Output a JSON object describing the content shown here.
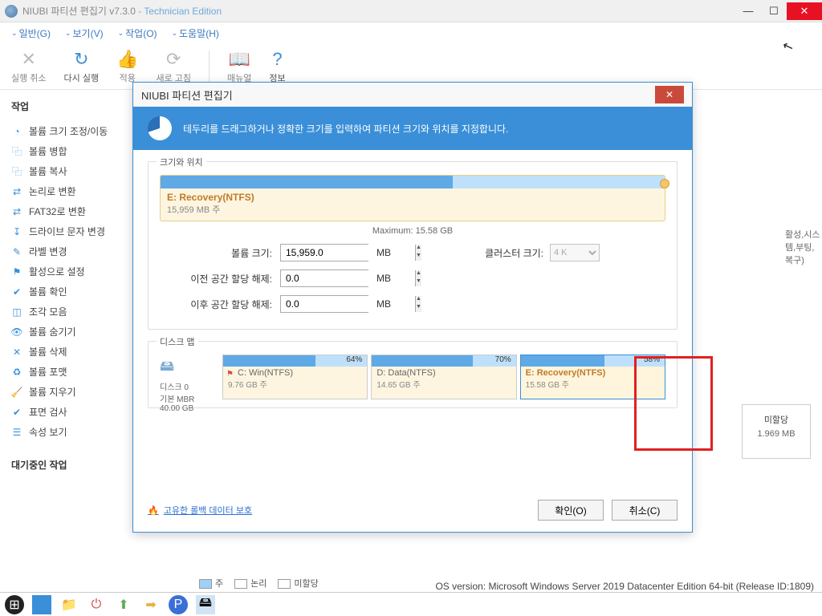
{
  "titlebar": {
    "name": "NIUBI 파티션 편집기 v7.3.0",
    "edition": " - Technician Edition"
  },
  "menu": {
    "general": "일반(G)",
    "view": "보기(V)",
    "action": "작업(O)",
    "help": "도움말(H)"
  },
  "toolbar": {
    "undo": "실행 취소",
    "redo": "다시 실행",
    "apply": "적용",
    "refresh": "새로 고침",
    "manual": "매뉴얼",
    "info": "정보"
  },
  "sidebar": {
    "header": "작업",
    "items": [
      "볼륨 크기 조정/이동",
      "볼륨 병합",
      "볼륨 복사",
      "논리로 변환",
      "FAT32로 변환",
      "드라이브 문자 변경",
      "라벨 변경",
      "활성으로 설정",
      "볼륨 확인",
      "조각 모음",
      "볼륨 숨기기",
      "볼륨 삭제",
      "볼륨 포맷",
      "볼륨 지우기",
      "표면 검사",
      "속성 보기"
    ],
    "pending": "대기중인 작업"
  },
  "back": {
    "badge": "활성,시스템,부팅,복구)",
    "unalloc": "미할당",
    "unalloc_sz": "1.969 MB"
  },
  "dialog": {
    "title": "NIUBI 파티션 편집기",
    "banner": "테두리를 드래그하거나 정확한 크기를 입력하여 파티션 크기와 위치를 지정합니다.",
    "group_size": "크기와 위치",
    "part_name": "E: Recovery(NTFS)",
    "part_size": "15,959 MB 주",
    "maximum": "Maximum: 15.58 GB",
    "lbl_volsize": "볼륨 크기:",
    "val_volsize": "15,959.0",
    "lbl_before": "이전 공간 할당 해제:",
    "val_before": "0.0",
    "lbl_after": "이후 공간 할당 해제:",
    "val_after": "0.0",
    "unit": "MB",
    "lbl_cluster": "클러스터 크기:",
    "val_cluster": "4 K",
    "group_map": "디스크 맵",
    "disk_label": "디스크 0",
    "disk_type": "기본 MBR",
    "disk_size": "40.00 GB",
    "parts": [
      {
        "pct": "64%",
        "fill": 64,
        "name": "C: Win(NTFS)",
        "size": "9.76 GB 주",
        "flag": true
      },
      {
        "pct": "70%",
        "fill": 70,
        "name": "D: Data(NTFS)",
        "size": "14.65 GB 주",
        "flag": false
      },
      {
        "pct": "58%",
        "fill": 58,
        "name": "E: Recovery(NTFS)",
        "size": "15.58 GB 주",
        "flag": false,
        "selected": true
      }
    ],
    "rollback": "고유한 롤백 데이터 보호",
    "ok": "확인(O)",
    "cancel": "취소(C)"
  },
  "legend": {
    "primary": "주",
    "logical": "논리",
    "unalloc": "미할당"
  },
  "status": "OS version: Microsoft Windows Server 2019 Datacenter Edition  64-bit  (Release ID:1809)"
}
